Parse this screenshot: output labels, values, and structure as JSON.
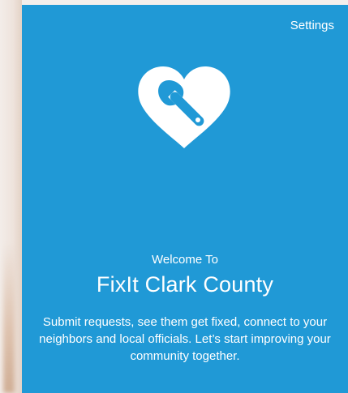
{
  "header": {
    "settings_label": "Settings"
  },
  "logo": {
    "icon": "heart-wrench-icon"
  },
  "welcome": {
    "subtitle": "Welcome To",
    "title": "FixIt Clark County",
    "description": "Submit requests, see them get fixed, connect to your neighbors and local officials. Let’s start improving your community together."
  },
  "colors": {
    "panel_background": "#2099d6",
    "text": "#ffffff"
  }
}
